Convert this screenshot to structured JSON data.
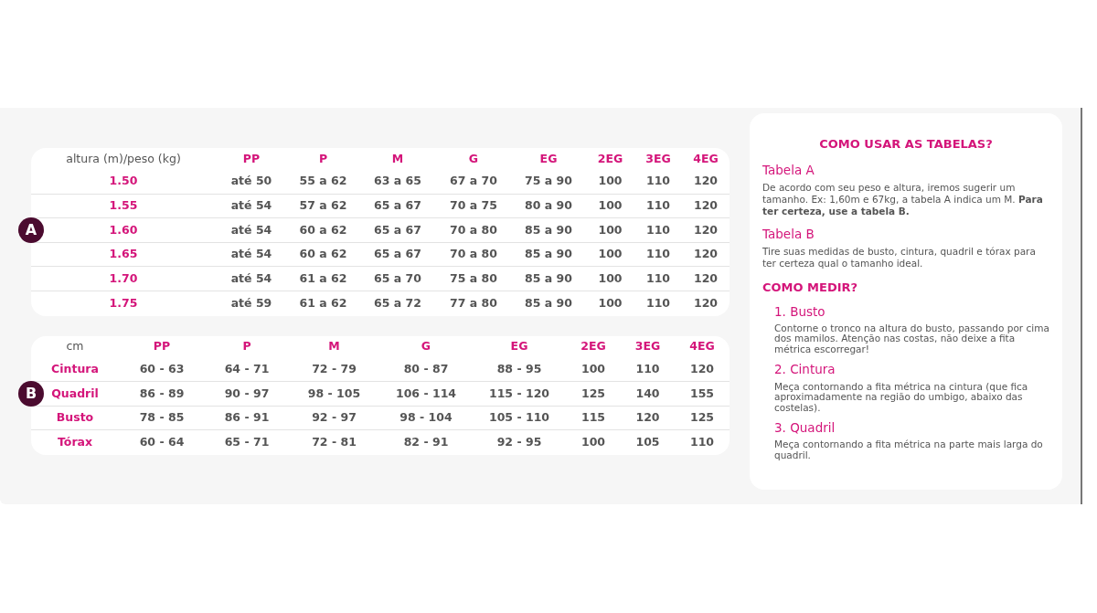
{
  "table_a": {
    "badge": "A",
    "columns": [
      "altura (m)/peso (kg)",
      "PP",
      "P",
      "M",
      "G",
      "EG",
      "2EG",
      "3EG",
      "4EG"
    ],
    "rows": [
      [
        "1.50",
        "até 50",
        "55 a 62",
        "63 a 65",
        "67 a 70",
        "75 a 90",
        "100",
        "110",
        "120"
      ],
      [
        "1.55",
        "até 54",
        "57 a 62",
        "65 a 67",
        "70 a 75",
        "80 a 90",
        "100",
        "110",
        "120"
      ],
      [
        "1.60",
        "até 54",
        "60 a 62",
        "65 a 67",
        "70 a 80",
        "85 a 90",
        "100",
        "110",
        "120"
      ],
      [
        "1.65",
        "até 54",
        "60 a 62",
        "65 a 67",
        "70 a 80",
        "85 a 90",
        "100",
        "110",
        "120"
      ],
      [
        "1.70",
        "até 54",
        "61 a 62",
        "65 a 70",
        "75 a 80",
        "85 a 90",
        "100",
        "110",
        "120"
      ],
      [
        "1.75",
        "até 59",
        "61 a 62",
        "65 a 72",
        "77 a 80",
        "85 a 90",
        "100",
        "110",
        "120"
      ]
    ]
  },
  "table_b": {
    "badge": "B",
    "columns": [
      "cm",
      "PP",
      "P",
      "M",
      "G",
      "EG",
      "2EG",
      "3EG",
      "4EG"
    ],
    "rows": [
      [
        "Cintura",
        "60 - 63",
        "64 - 71",
        "72 - 79",
        "80 - 87",
        "88 - 95",
        "100",
        "110",
        "120"
      ],
      [
        "Quadril",
        "86 - 89",
        "90 - 97",
        "98 - 105",
        "106 - 114",
        "115 - 120",
        "125",
        "140",
        "155"
      ],
      [
        "Busto",
        "78 - 85",
        "86 - 91",
        "92 - 97",
        "98 - 104",
        "105 - 110",
        "115",
        "120",
        "125"
      ],
      [
        "Tórax",
        "60 - 64",
        "65 - 71",
        "72 - 81",
        "82 - 91",
        "92 - 95",
        "100",
        "105",
        "110"
      ]
    ]
  },
  "guide": {
    "title": "COMO USAR AS TABELAS?",
    "sections": [
      {
        "heading": "Tabela A",
        "text": "De acordo com seu peso e altura, iremos sugerir um tamanho. Ex: 1,60m e 67kg, a tabela A indica um M. **Para ter certeza, use a tabela B.**"
      },
      {
        "heading": "Tabela B",
        "text": "Tire suas medidas de busto, cintura, quadril e tórax para ter certeza qual o tamanho ideal."
      }
    ],
    "measure_title": "COMO MEDIR?",
    "steps": [
      {
        "heading": "1. Busto",
        "text": "Contorne o tronco na altura do busto, passando por cima dos mamilos. Atenção nas costas, não deixe a fita métrica escorregar!"
      },
      {
        "heading": "2. Cintura",
        "text": "Meça contornando a fita métrica na cintura (que fica aproximadamente na região do umbigo, abaixo das costelas)."
      },
      {
        "heading": "3. Quadril",
        "text": "Meça contornando a fita métrica na parte mais larga do quadril."
      }
    ]
  }
}
